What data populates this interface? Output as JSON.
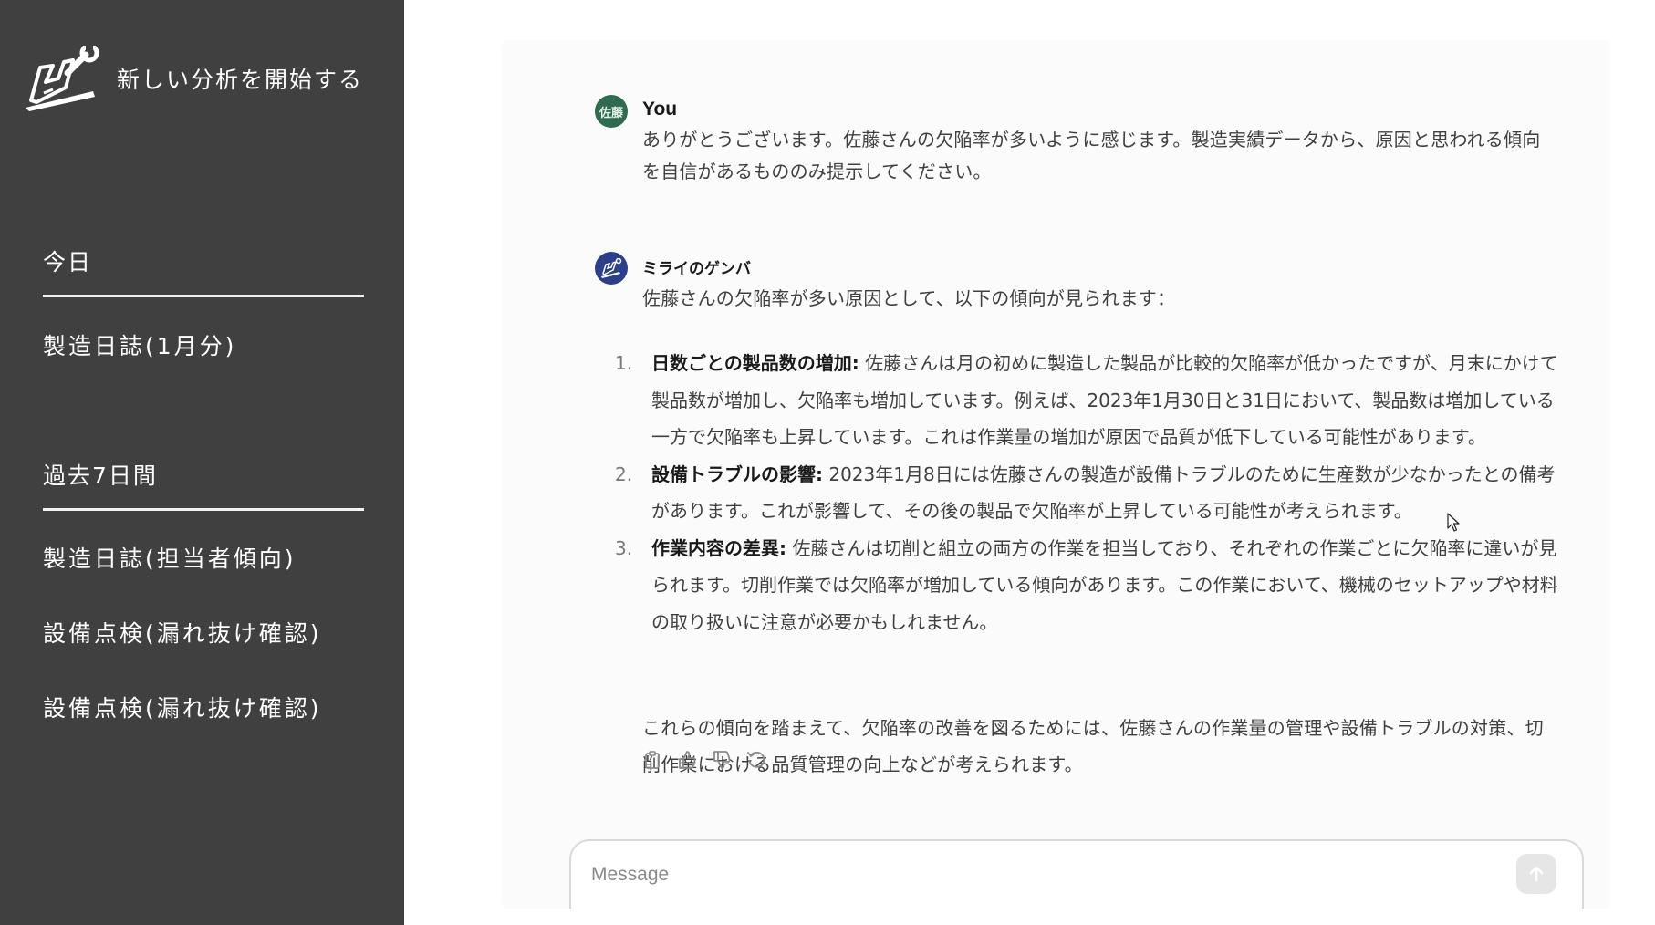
{
  "sidebar": {
    "new_analysis_label": "新しい分析を開始する",
    "sections": [
      {
        "heading": "今日",
        "items": [
          "製造日誌(1月分)"
        ]
      },
      {
        "heading": "過去7日間",
        "items": [
          "製造日誌(担当者傾向)",
          "設備点検(漏れ抜け確認)",
          "設備点検(漏れ抜け確認)"
        ]
      }
    ]
  },
  "chat": {
    "user_message": {
      "avatar_text": "佐藤",
      "author": "You",
      "text": "ありがとうございます。佐藤さんの欠陥率が多いように感じます。製造実績データから、原因と思われる傾向を自信があるもののみ提示してください。"
    },
    "bot_message": {
      "author": "ミライのゲンバ",
      "intro": "佐藤さんの欠陥率が多い原因として、以下の傾向が見られます：",
      "items": [
        {
          "number": "1.",
          "title": "日数ごとの製品数の増加:",
          "text": " 佐藤さんは月の初めに製造した製品が比較的欠陥率が低かったですが、月末にかけて製品数が増加し、欠陥率も増加しています。例えば、2023年1月30日と31日において、製品数は増加している一方で欠陥率も上昇しています。これは作業量の増加が原因で品質が低下している可能性があります。"
        },
        {
          "number": "2.",
          "title": "設備トラブルの影響:",
          "text": " 2023年1月8日には佐藤さんの製造が設備トラブルのために生産数が少なかったとの備考があります。これが影響して、その後の製品で欠陥率が上昇している可能性が考えられます。"
        },
        {
          "number": "3.",
          "title": "作業内容の差異:",
          "text": " 佐藤さんは切削と組立の両方の作業を担当しており、それぞれの作業ごとに欠陥率に違いが見られます。切削作業では欠陥率が増加している傾向があります。この作業において、機械のセットアップや材料の取り扱いに注意が必要かもしれません。"
        }
      ],
      "conclusion": "これらの傾向を踏まえて、欠陥率の改善を図るためには、佐藤さんの作業量の管理や設備トラブルの対策、切削作業における品質管理の向上などが考えられます。"
    }
  },
  "composer": {
    "placeholder": "Message"
  }
}
